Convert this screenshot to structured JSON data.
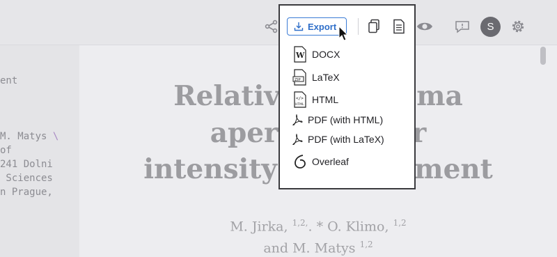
{
  "toolbar": {
    "export_label": "Export",
    "avatar_initial": "S"
  },
  "export_menu": {
    "items": [
      {
        "label": "DOCX",
        "icon": "word-doc-icon"
      },
      {
        "label": "LaTeX",
        "icon": "zip-file-icon"
      },
      {
        "label": "HTML",
        "icon": "html-file-icon"
      },
      {
        "label": "PDF (with HTML)",
        "icon": "pdf-icon"
      },
      {
        "label": "PDF (with LaTeX)",
        "icon": "pdf-icon"
      },
      {
        "label": "Overleaf",
        "icon": "overleaf-icon"
      }
    ]
  },
  "source_editor": {
    "lines": [
      "ent",
      "M. Matys",
      "of",
      "241 Dolni",
      " Sciences",
      "n Prague,"
    ],
    "line_break_token": "\\"
  },
  "document": {
    "title_lines": [
      "Relativistic plasma",
      "aperture laser",
      "intensity enhancement"
    ],
    "authors_line1": {
      "a1": "M. Jirka,",
      "s1": "1,2,",
      "mid": ". * O. Klimo,",
      "s2": "1,2"
    },
    "authors_line2": {
      "a": "and M. Matys",
      "s": "1,2"
    }
  },
  "colors": {
    "accent": "#2f6fc9",
    "frame": "#3a3a3e"
  }
}
